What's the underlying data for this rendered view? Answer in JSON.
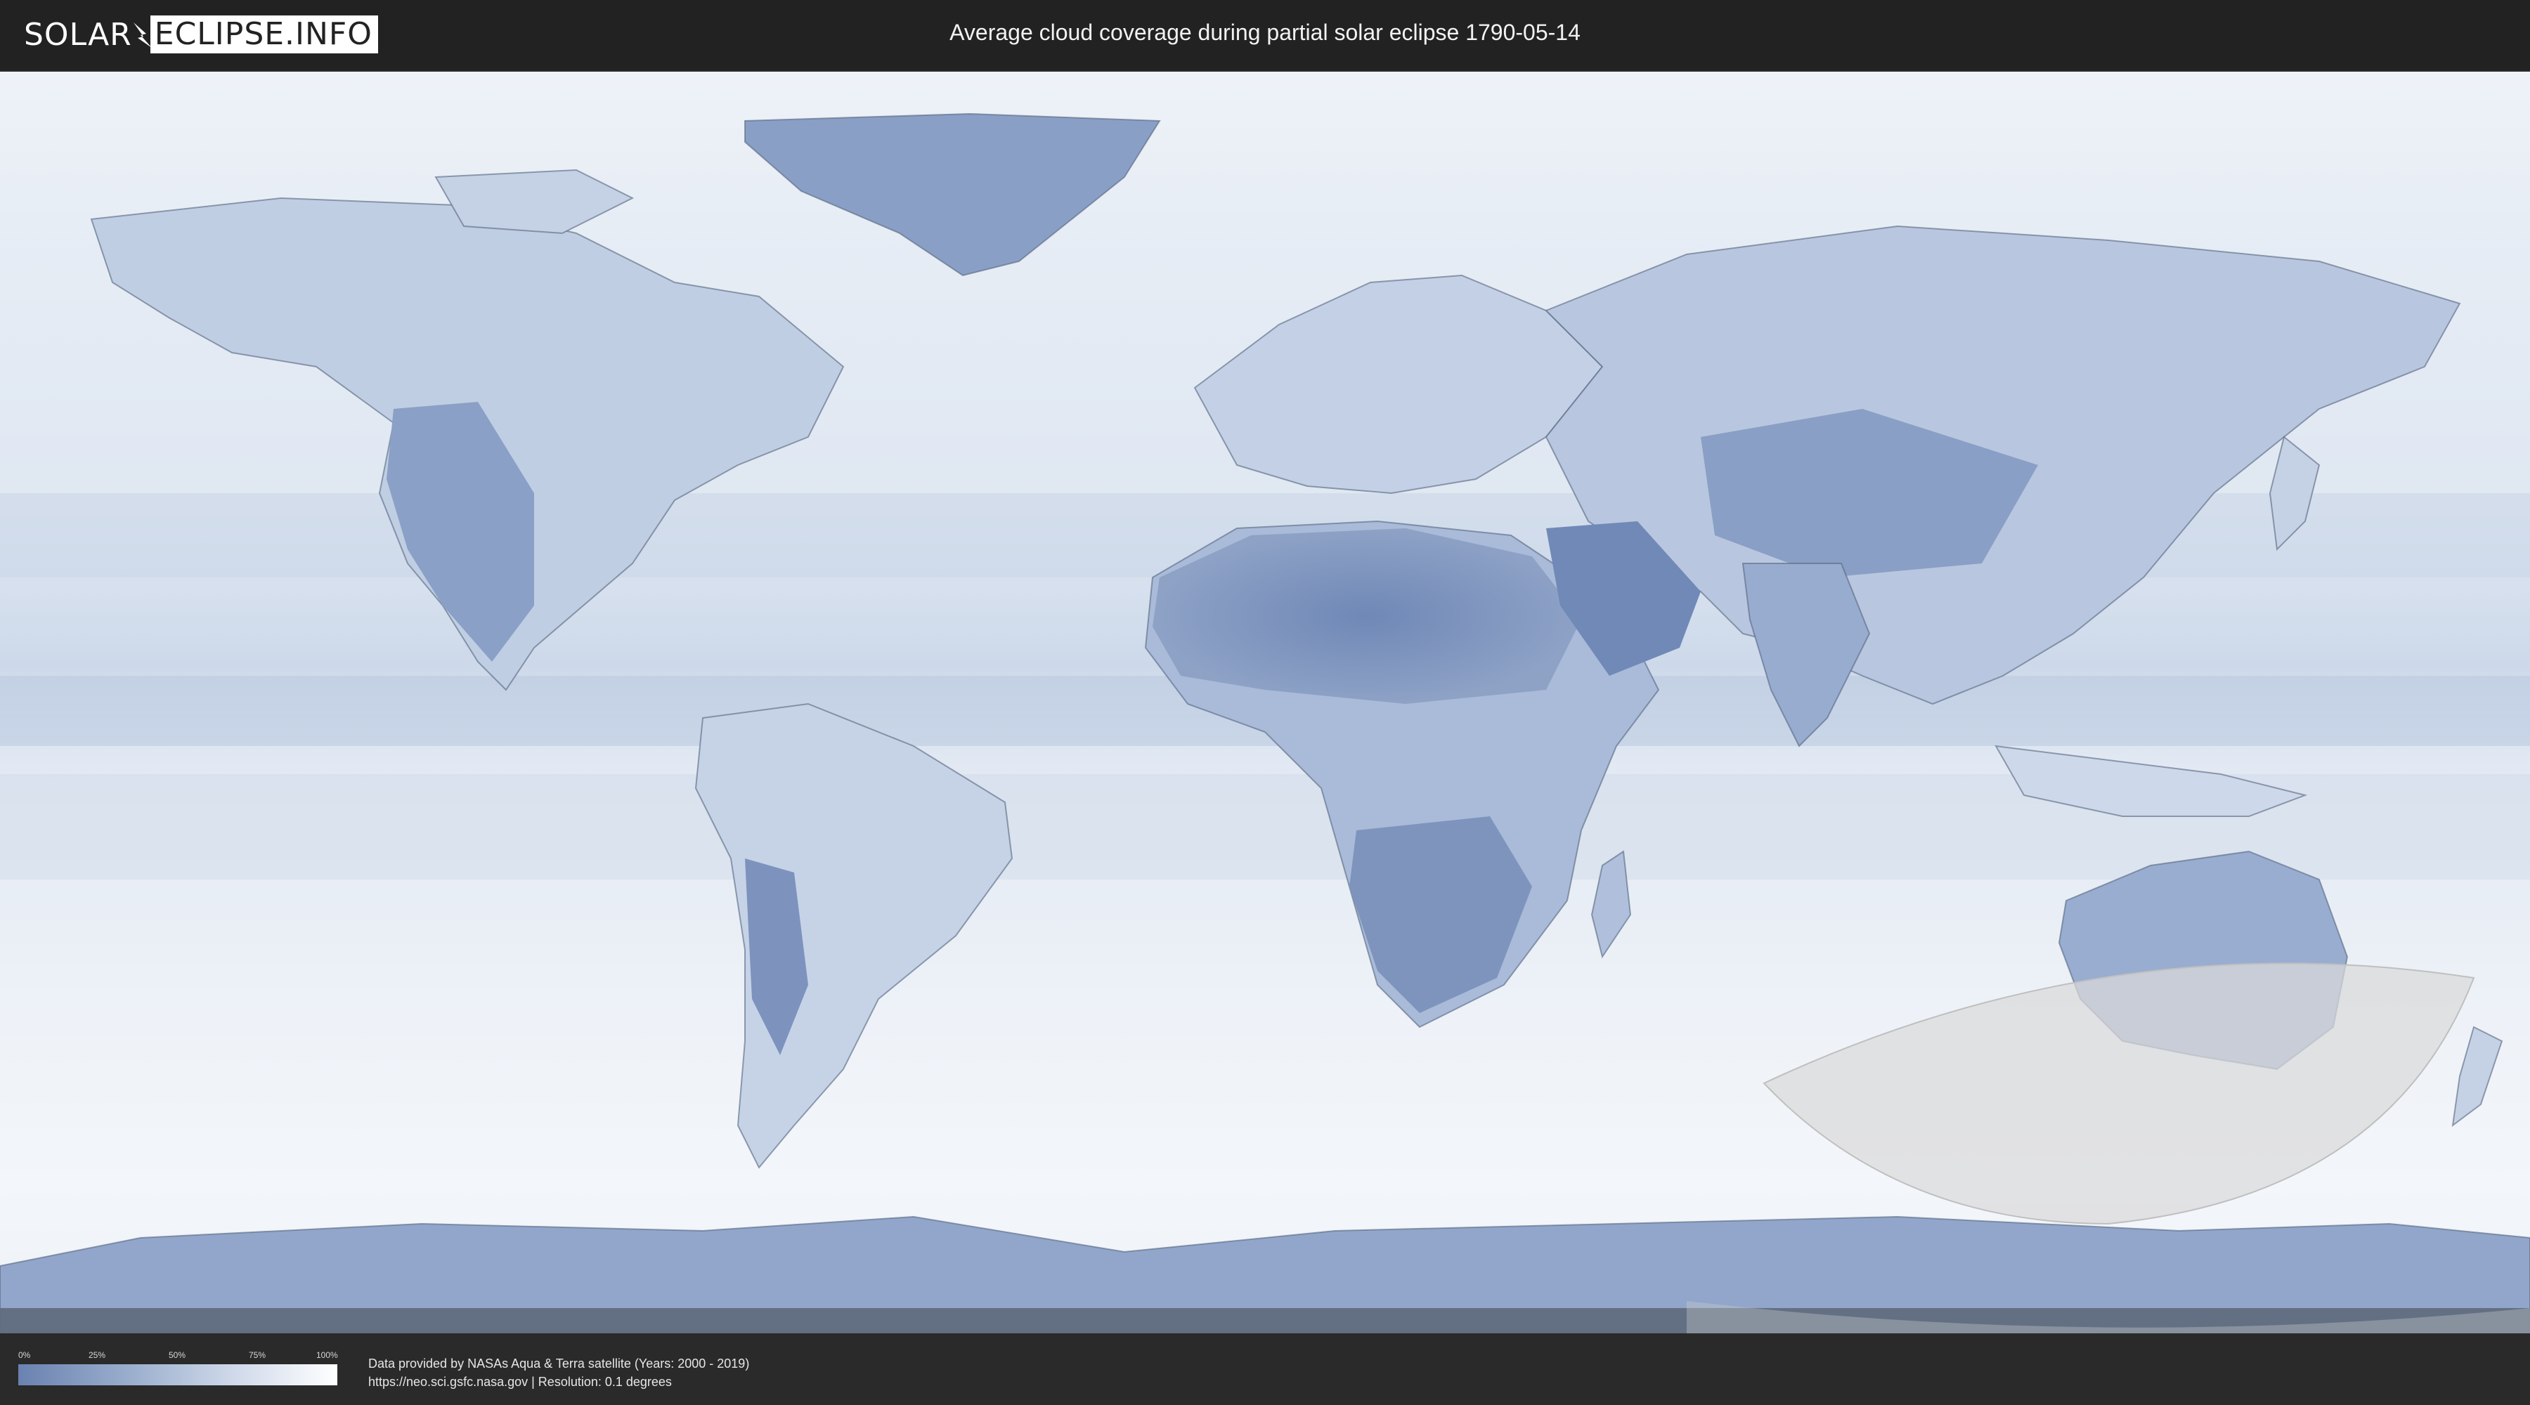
{
  "header": {
    "logo_left": "SOLAR",
    "logo_right": "ECLIPSE.INFO",
    "title": "Average cloud coverage during partial solar eclipse 1790-05-14"
  },
  "legend": {
    "ticks": [
      "0%",
      "25%",
      "50%",
      "75%",
      "100%"
    ],
    "gradient_colors": [
      "#6a82b0",
      "#9aaecd",
      "#d3dcec",
      "#ffffff"
    ]
  },
  "credits": {
    "line1": "Data provided by NASAs Aqua & Terra satellite (Years: 2000 - 2019)",
    "line2": "https://neo.sci.gsfc.nasa.gov | Resolution: 0.1 degrees"
  },
  "colors": {
    "ocean_cloud": "#e4ebf4",
    "land_clear": "#6f88b6",
    "eclipse_zone": "#d9d9d9",
    "border": "#2f3f55"
  }
}
